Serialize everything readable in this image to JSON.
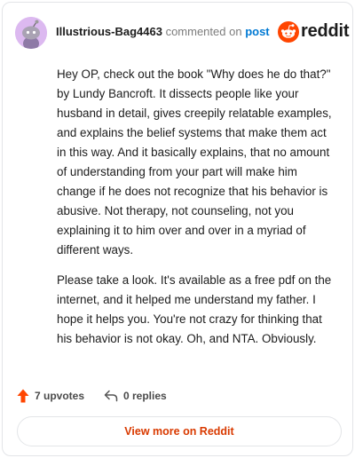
{
  "header": {
    "username": "Illustrious-Bag4463",
    "commented_on": "commented on",
    "post_link": "post",
    "brand": "reddit"
  },
  "comment": {
    "paragraphs": [
      "Hey OP, check out the book \"Why does he do that?\" by Lundy Bancroft. It dissects people like your husband in detail, gives creepily relatable examples, and explains the belief systems that make them act in this way. And it basically explains, that no amount of understanding from your part will make him change if he does not recognize that his behavior is abusive. Not therapy, not counseling, not you explaining it to him over and over in a myriad of different ways.",
      "Please take a look. It's available as a free pdf on the internet, and it helped me understand my father. I hope it helps you. You're not crazy for thinking that his behavior is not okay. Oh, and NTA. Obviously."
    ]
  },
  "actions": {
    "upvotes": "7 upvotes",
    "replies": "0 replies"
  },
  "footer": {
    "view_more": "View more on Reddit"
  },
  "colors": {
    "brand_orange": "#ff4500",
    "upvote": "#ff4500",
    "link_blue": "#0079d3",
    "avatar_bg": "#dcb9f0",
    "view_more_text": "#d93a00"
  },
  "icons": {
    "avatar": "snoo-avatar",
    "logo": "reddit-logo-icon",
    "upvote": "upvote-arrow-icon",
    "reply": "reply-arrow-icon"
  }
}
